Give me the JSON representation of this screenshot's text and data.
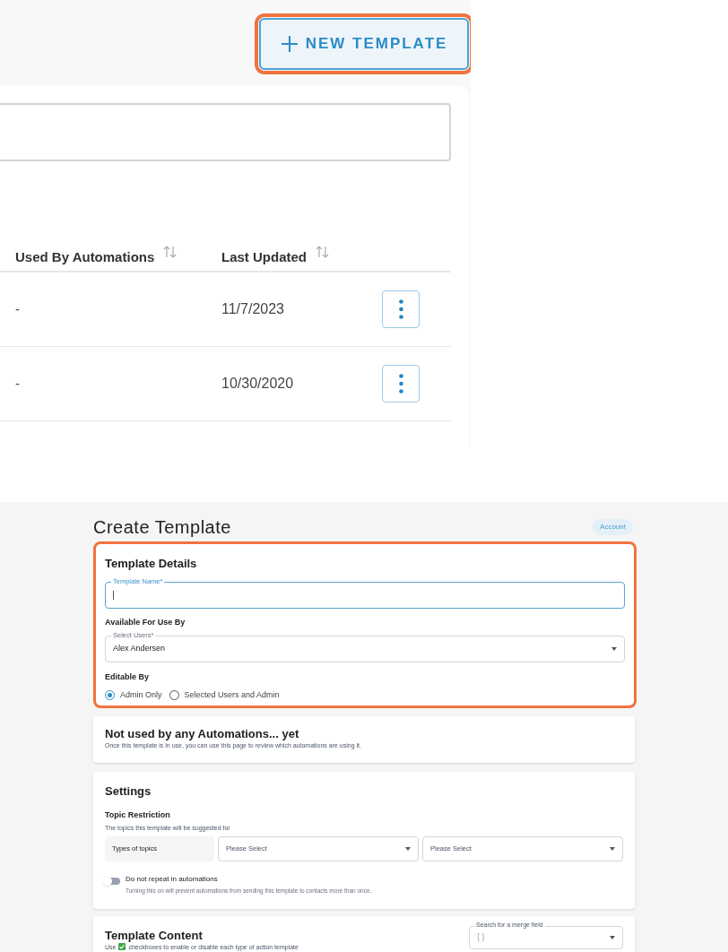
{
  "new_template_button": {
    "label": "NEW TEMPLATE",
    "highlighted": true
  },
  "table": {
    "columns": [
      {
        "label": "Used By Automations",
        "sortable": true
      },
      {
        "label": "Last Updated",
        "sortable": true
      }
    ],
    "rows": [
      {
        "cells": [
          "-",
          "11/7/2023"
        ]
      },
      {
        "cells": [
          "-",
          "10/30/2020"
        ]
      }
    ]
  },
  "page": {
    "title": "Create Template",
    "account_badge": "Account"
  },
  "template_details": {
    "heading": "Template Details",
    "highlighted": true,
    "name_field": {
      "label": "Template Name*",
      "focused": true
    },
    "available_heading": "Available For Use By",
    "users_select": {
      "label": "Select Users*",
      "value": "Alex Andersen"
    },
    "editable_heading": "Editable By",
    "editable_options": [
      {
        "label": "Admin Only",
        "selected": true
      },
      {
        "label": "Selected Users and Admin",
        "selected": false
      }
    ]
  },
  "automations": {
    "heading": "Not used by any Automations... yet",
    "note": "Once this template is in use, you can use this page to review which automations are using it."
  },
  "settings": {
    "heading": "Settings",
    "topic_heading": "Topic Restriction",
    "topic_note": "The topics this template will be suggested for",
    "topic_label": "Types of topics",
    "topic_selects": [
      {
        "placeholder": "Please Select"
      },
      {
        "placeholder": "Please Select"
      }
    ],
    "no_repeat": {
      "label": "Do not repeat in automations",
      "note": "Turning this on will prevent automations from sending this template to contacts more than once.",
      "on": false
    }
  },
  "template_content": {
    "heading": "Template Content",
    "instructions_before": "Use",
    "instructions_after": "checkboxes to enable or disable each type of action template",
    "merge_field": {
      "label": "Search for a merge field",
      "placeholder": "{ }"
    }
  }
}
